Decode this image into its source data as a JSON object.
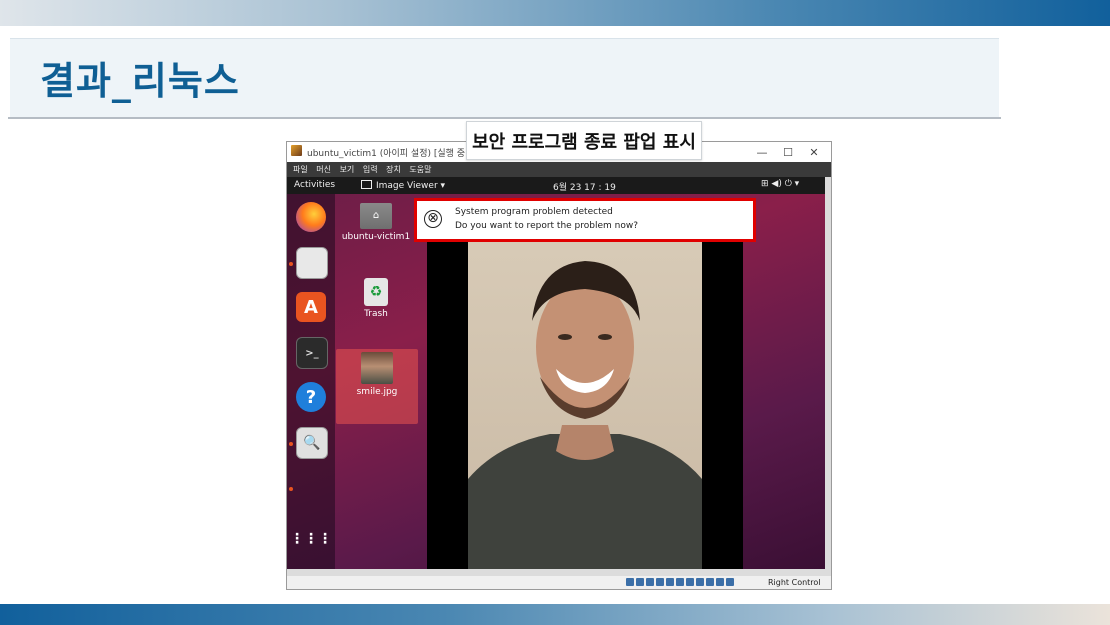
{
  "slide": {
    "title": "결과_리눅스",
    "callout": "보안 프로그램 종료 팝업 표시"
  },
  "vbox": {
    "window_title": "ubuntu_victim1 (아이피 설정) [실행 중] - Ora",
    "controls": [
      "—",
      "☐",
      "✕"
    ],
    "menu": [
      "파일",
      "머신",
      "보기",
      "입력",
      "장치",
      "도움말"
    ],
    "status_right": "Right Control"
  },
  "gnome": {
    "activities": "Activities",
    "app_menu": "Image Viewer ▾",
    "clock": "6월 23  17 : 19",
    "tray": "⊞  ◀)  ⏻  ▾"
  },
  "desktop": {
    "home_label": "ubuntu-victim1",
    "trash_label": "Trash",
    "file_label": "smile.jpg"
  },
  "popup": {
    "line1": "System program problem detected",
    "line2": "Do you want to report the problem now?",
    "icon": "⊗"
  },
  "colors": {
    "accent_red": "#e00000",
    "title_blue": "#0f5f94",
    "ubuntu_orange": "#e95420"
  }
}
